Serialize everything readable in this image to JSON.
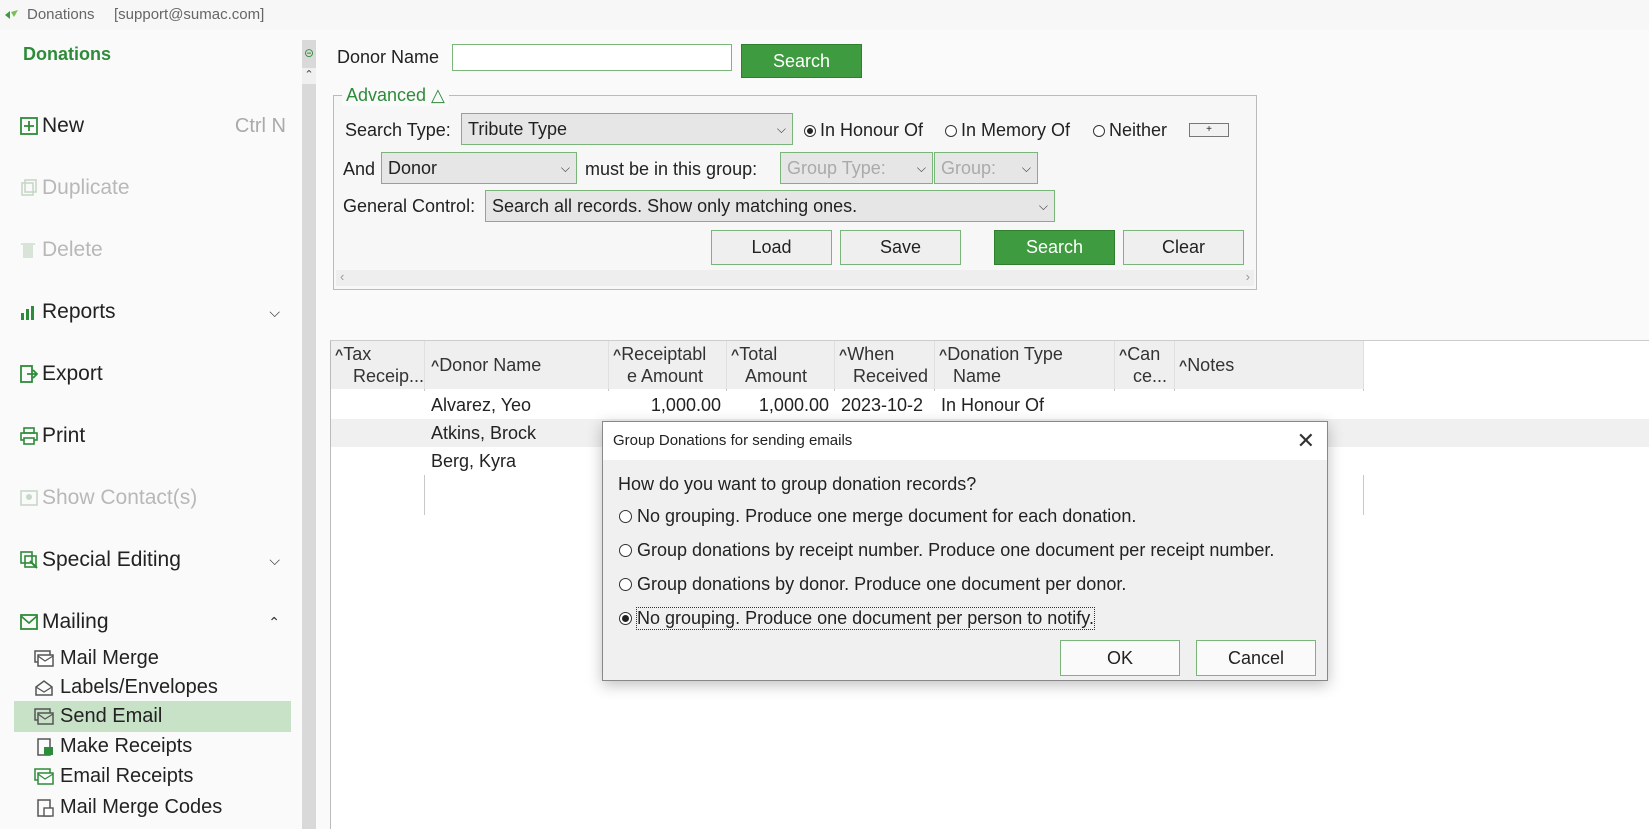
{
  "titlebar": {
    "app": "Donations",
    "account": "[support@sumac.com]"
  },
  "sidebar": {
    "heading": "Donations",
    "items": [
      {
        "label": "New",
        "shortcut": "Ctrl N",
        "icon": "plus-square-icon",
        "enabled": true
      },
      {
        "label": "Duplicate",
        "icon": "duplicate-icon",
        "enabled": false
      },
      {
        "label": "Delete",
        "icon": "trash-icon",
        "enabled": false
      },
      {
        "label": "Reports",
        "icon": "bar-chart-icon",
        "enabled": true,
        "expanded": false
      },
      {
        "label": "Export",
        "icon": "export-icon",
        "enabled": true
      },
      {
        "label": "Print",
        "icon": "printer-icon",
        "enabled": true
      },
      {
        "label": "Show Contact(s)",
        "icon": "contacts-icon",
        "enabled": false
      },
      {
        "label": "Special Editing",
        "icon": "special-edit-icon",
        "enabled": true,
        "expanded": false
      },
      {
        "label": "Mailing",
        "icon": "mail-icon",
        "enabled": true,
        "expanded": true
      }
    ],
    "mailing_subitems": [
      {
        "label": "Mail Merge",
        "icon": "mail-merge-icon"
      },
      {
        "label": "Labels/Envelopes",
        "icon": "envelope-icon"
      },
      {
        "label": "Send Email",
        "icon": "send-email-icon",
        "selected": true
      },
      {
        "label": "Make Receipts",
        "icon": "receipt-icon"
      },
      {
        "label": "Email Receipts",
        "icon": "email-receipt-icon"
      },
      {
        "label": "Mail Merge Codes",
        "icon": "codes-icon"
      }
    ]
  },
  "search": {
    "donor_name_label": "Donor Name",
    "donor_name_value": "",
    "search_button": "Search"
  },
  "advanced": {
    "legend": "Advanced △",
    "search_type_label": "Search Type:",
    "search_type_value": "Tribute Type",
    "radios": [
      {
        "label": "In Honour Of",
        "checked": true
      },
      {
        "label": "In Memory Of",
        "checked": false
      },
      {
        "label": "Neither",
        "checked": false
      }
    ],
    "plus_button": "+",
    "and_label": "And",
    "and_value": "Donor",
    "group_label": "must be in this group:",
    "group_type_value": "Group Type:",
    "group_value": "Group:",
    "general_control_label": "General Control:",
    "general_control_value": "Search all records. Show only matching ones.",
    "buttons": {
      "load": "Load",
      "save": "Save",
      "search": "Search",
      "clear": "Clear"
    }
  },
  "table": {
    "columns": [
      {
        "line1": "Tax",
        "line2": "Receip..."
      },
      {
        "line1": "Donor Name",
        "line2": ""
      },
      {
        "line1": "Receiptabl",
        "line2": "e Amount"
      },
      {
        "line1": "Total",
        "line2": "Amount"
      },
      {
        "line1": "When",
        "line2": "Received"
      },
      {
        "line1": "Donation Type",
        "line2": "Name"
      },
      {
        "line1": "Can",
        "line2": "ce..."
      },
      {
        "line1": "Notes",
        "line2": ""
      }
    ],
    "rows": [
      {
        "tax_receipt": "",
        "donor": "Alvarez, Yeo",
        "receiptable": "1,000.00",
        "total": "1,000.00",
        "when": "2023-10-2",
        "type": "In Honour Of",
        "cancel": "",
        "notes": ""
      },
      {
        "tax_receipt": "",
        "donor": "Atkins, Brock",
        "receiptable": "",
        "total": "",
        "when": "",
        "type": "",
        "cancel": "",
        "notes": ""
      },
      {
        "tax_receipt": "",
        "donor": "Berg, Kyra",
        "receiptable": "",
        "total": "",
        "when": "",
        "type": "",
        "cancel": "",
        "notes": ""
      }
    ]
  },
  "dialog": {
    "title": "Group Donations for sending emails",
    "question": "How do you want to group donation records?",
    "options": [
      {
        "label": "No grouping. Produce one merge document for each donation.",
        "checked": false
      },
      {
        "label": "Group donations by receipt number. Produce one document per receipt number.",
        "checked": false
      },
      {
        "label": "Group donations by donor. Produce one document per donor.",
        "checked": false
      },
      {
        "label": "No grouping. Produce one document per person to notify.",
        "checked": true
      }
    ],
    "ok": "OK",
    "cancel": "Cancel"
  },
  "colors": {
    "accent": "#3f9b3f",
    "selected_bg": "#c7e2c7",
    "brand_text": "#2e8b3a"
  }
}
